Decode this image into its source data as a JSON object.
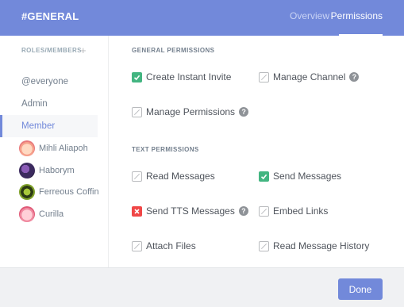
{
  "header": {
    "title": "#GENERAL",
    "tabs": [
      {
        "label": "Overview",
        "active": false
      },
      {
        "label": "Permissions",
        "active": true
      }
    ]
  },
  "sidebar": {
    "heading": "ROLES/MEMBERS",
    "add_icon": "plus-icon",
    "roles": [
      {
        "label": "@everyone",
        "selected": false
      },
      {
        "label": "Admin",
        "selected": false
      },
      {
        "label": "Member",
        "selected": true
      }
    ],
    "members": [
      {
        "name": "Mihli Aliapoh"
      },
      {
        "name": "Haborym"
      },
      {
        "name": "Ferreous Coffin"
      },
      {
        "name": "Curilla"
      }
    ]
  },
  "general_permissions": {
    "heading": "GENERAL PERMISSIONS",
    "items": [
      {
        "label": "Create Instant Invite",
        "state": "allow",
        "help": false
      },
      {
        "label": "Manage Channel",
        "state": "neutral",
        "help": true
      },
      {
        "label": "Manage Permissions",
        "state": "neutral",
        "help": true
      }
    ]
  },
  "text_permissions": {
    "heading": "TEXT PERMISSIONS",
    "items": [
      {
        "label": "Read Messages",
        "state": "neutral",
        "help": false
      },
      {
        "label": "Send Messages",
        "state": "allow",
        "help": false
      },
      {
        "label": "Send TTS Messages",
        "state": "deny",
        "help": true
      },
      {
        "label": "Embed Links",
        "state": "neutral",
        "help": false
      },
      {
        "label": "Attach Files",
        "state": "neutral",
        "help": false
      },
      {
        "label": "Read Message History",
        "state": "neutral",
        "help": false
      }
    ]
  },
  "help_glyph": "?",
  "footer": {
    "done_label": "Done"
  },
  "colors": {
    "accent": "#7289da",
    "allow": "#43b581",
    "deny": "#f04747",
    "neutral": "#b9bbbe"
  }
}
